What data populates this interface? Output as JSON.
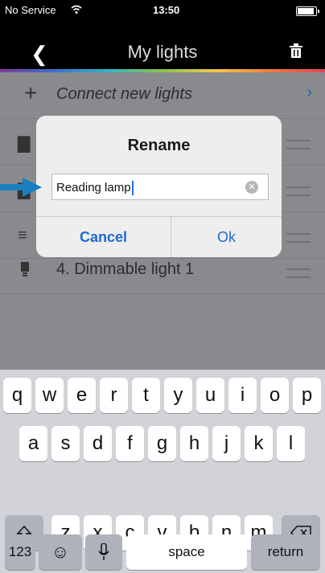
{
  "status": {
    "carrier": "No Service",
    "time": "13:50",
    "battery_level": 0.9
  },
  "nav": {
    "title": "My lights"
  },
  "list": {
    "connect_label": "Connect new lights",
    "last_row_label": "4. Dimmable light 1"
  },
  "dialog": {
    "title": "Rename",
    "input_value": "Reading lamp",
    "cancel_label": "Cancel",
    "ok_label": "Ok"
  },
  "keyboard": {
    "row1": [
      "q",
      "w",
      "e",
      "r",
      "t",
      "y",
      "u",
      "i",
      "o",
      "p"
    ],
    "row2": [
      "a",
      "s",
      "d",
      "f",
      "g",
      "h",
      "j",
      "k",
      "l"
    ],
    "row3": [
      "z",
      "x",
      "c",
      "v",
      "b",
      "n",
      "m"
    ],
    "numbers_label": "123",
    "space_label": "space",
    "return_label": "return"
  },
  "colors": {
    "accent": "#1e6ad0",
    "arrow": "#1a7fbf"
  }
}
